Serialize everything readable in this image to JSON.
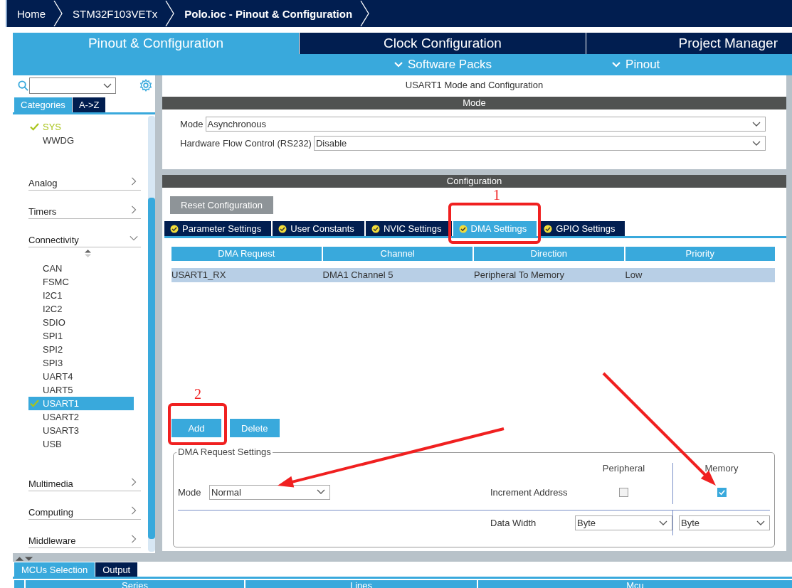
{
  "breadcrumbs": [
    {
      "label": "Home",
      "current": false
    },
    {
      "label": "STM32F103VETx",
      "current": false
    },
    {
      "label": "Polo.ioc - Pinout & Configuration",
      "current": true
    }
  ],
  "main_tabs": [
    {
      "label": "Pinout & Configuration",
      "selected": true
    },
    {
      "label": "Clock Configuration",
      "selected": false
    },
    {
      "label": "Project Manager",
      "selected": false
    }
  ],
  "sub_menus": [
    "Software Packs",
    "Pinout"
  ],
  "sidebar": {
    "view_tabs": [
      {
        "label": "Categories",
        "selected": true
      },
      {
        "label": "A->Z",
        "selected": false
      }
    ],
    "top_items": [
      {
        "label": "SYS",
        "checked": true
      },
      {
        "label": "WWDG",
        "checked": false
      }
    ],
    "categories": [
      {
        "label": "Analog",
        "expanded": false
      },
      {
        "label": "Timers",
        "expanded": false
      },
      {
        "label": "Connectivity",
        "expanded": true,
        "children": [
          {
            "label": "CAN",
            "checked": false,
            "selected": false
          },
          {
            "label": "FSMC",
            "checked": false,
            "selected": false
          },
          {
            "label": "I2C1",
            "checked": false,
            "selected": false
          },
          {
            "label": "I2C2",
            "checked": false,
            "selected": false
          },
          {
            "label": "SDIO",
            "checked": false,
            "selected": false
          },
          {
            "label": "SPI1",
            "checked": false,
            "selected": false
          },
          {
            "label": "SPI2",
            "checked": false,
            "selected": false
          },
          {
            "label": "SPI3",
            "checked": false,
            "selected": false
          },
          {
            "label": "UART4",
            "checked": false,
            "selected": false
          },
          {
            "label": "UART5",
            "checked": false,
            "selected": false
          },
          {
            "label": "USART1",
            "checked": true,
            "selected": true
          },
          {
            "label": "USART2",
            "checked": false,
            "selected": false
          },
          {
            "label": "USART3",
            "checked": false,
            "selected": false
          },
          {
            "label": "USB",
            "checked": false,
            "selected": false
          }
        ]
      },
      {
        "label": "Multimedia",
        "expanded": false
      },
      {
        "label": "Computing",
        "expanded": false
      },
      {
        "label": "Middleware",
        "expanded": false
      }
    ]
  },
  "panel": {
    "title": "USART1 Mode and Configuration",
    "mode_heading": "Mode",
    "mode_fields": [
      {
        "label": "Mode",
        "value": "Asynchronous"
      },
      {
        "label": "Hardware Flow Control (RS232)",
        "value": "Disable"
      }
    ],
    "configuration_heading": "Configuration",
    "reset_button": "Reset Configuration",
    "tabs": [
      {
        "label": "Parameter Settings",
        "selected": false
      },
      {
        "label": "User Constants",
        "selected": false
      },
      {
        "label": "NVIC Settings",
        "selected": false
      },
      {
        "label": "DMA Settings",
        "selected": true
      },
      {
        "label": "GPIO Settings",
        "selected": false
      }
    ],
    "table": {
      "columns": [
        "DMA Request",
        "Channel",
        "Direction",
        "Priority"
      ],
      "rows": [
        {
          "cells": [
            "USART1_RX",
            "DMA1 Channel 5",
            "Peripheral To Memory",
            "Low"
          ],
          "selected": true
        }
      ]
    },
    "buttons": [
      "Add",
      "Delete"
    ],
    "request_settings": {
      "title": "DMA Request Settings",
      "column_headings": [
        "Peripheral",
        "Memory"
      ],
      "mode": {
        "label": "Mode",
        "value": "Normal"
      },
      "increment": {
        "label": "Increment Address",
        "peripheral_checked": false,
        "memory_checked": true
      },
      "data_width": {
        "label": "Data Width",
        "peripheral": "Byte",
        "memory": "Byte"
      }
    }
  },
  "bottom": {
    "tabs": [
      {
        "label": "MCUs Selection",
        "selected": true
      },
      {
        "label": "Output",
        "selected": false
      }
    ],
    "columns": [
      "Series",
      "Lines",
      "Mcu"
    ]
  },
  "annotations": {
    "boxes": [
      "1",
      "2"
    ],
    "arrows": [
      {
        "kind": "arrow"
      },
      {
        "kind": "arrow"
      }
    ]
  }
}
